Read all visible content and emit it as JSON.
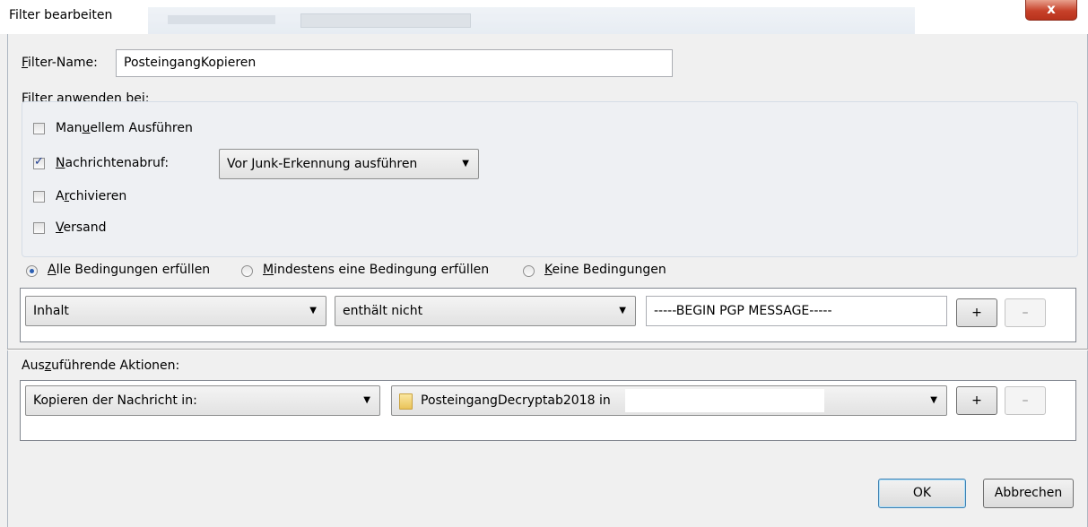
{
  "window": {
    "title": "Filter bearbeiten",
    "close_glyph": "x"
  },
  "filter_name": {
    "label_prefix": "F",
    "label_rest": "ilter-Name:",
    "value": "PosteingangKopieren"
  },
  "apply_group": {
    "legend": "Filter anwenden bei:",
    "options": [
      {
        "pre": "Man",
        "key": "u",
        "post": "ellem Ausführen",
        "checked": false
      },
      {
        "pre": "",
        "key": "N",
        "post": "achrichtenabruf:",
        "checked": true
      },
      {
        "pre": "A",
        "key": "r",
        "post": "chivieren",
        "checked": false
      },
      {
        "pre": "",
        "key": "V",
        "post": "ersand",
        "checked": false
      }
    ],
    "junk_dropdown": "Vor Junk-Erkennung ausführen"
  },
  "match_mode": {
    "options": [
      {
        "pre": "",
        "key": "A",
        "post": "lle Bedingungen erfüllen",
        "selected": true
      },
      {
        "pre": "",
        "key": "M",
        "post": "indestens eine Bedingung erfüllen",
        "selected": false
      },
      {
        "pre": "",
        "key": "K",
        "post": "eine Bedingungen",
        "selected": false
      }
    ]
  },
  "condition": {
    "field": "Inhalt",
    "operator": "enthält nicht",
    "value": "-----BEGIN PGP MESSAGE-----",
    "add_label": "+",
    "remove_label": "–"
  },
  "actions": {
    "label_pre": "Aus",
    "label_key": "z",
    "label_post": "uführende Aktionen:",
    "action": "Kopieren der Nachricht in:",
    "target": "PosteingangDecryptab2018 in",
    "target_icon": "folder-icon",
    "add_label": "+",
    "remove_label": "–"
  },
  "buttons": {
    "ok": "OK",
    "cancel": "Abbrechen"
  }
}
